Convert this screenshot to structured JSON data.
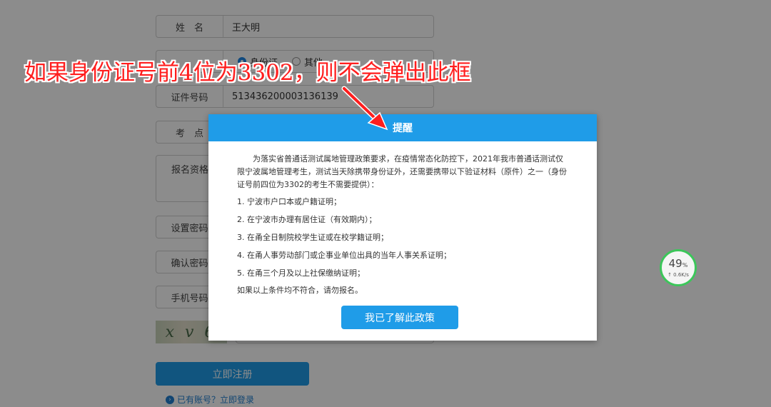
{
  "form": {
    "name_label": "姓　名",
    "name_value": "王大明",
    "idtype_option1": "身份证",
    "idtype_option2": "其他",
    "idno_label": "证件号码",
    "idno_value": "513436200003136139",
    "exam_label": "考　点",
    "qual_label": "报名资格",
    "pwd_label": "设置密码",
    "confirm_label": "确认密码",
    "phone_label": "手机号码",
    "captcha_text": "x v 6",
    "register_label": "立即注册",
    "login_prompt": "已有账号？立即登录"
  },
  "annotation": {
    "text": "如果身份证号前4位为3302，则不会弹出此框"
  },
  "modal": {
    "title": "提醒",
    "intro": "为落实省普通话测试属地管理政策要求，在疫情常态化防控下，2021年我市普通话测试仅限宁波属地管理考生，测试当天除携带身份证外，还需要携带以下验证材料（原件）之一（身份证号前四位为3302的考生不需要提供）：",
    "items": [
      "1. 宁波市户口本或户籍证明；",
      "2. 在宁波市办理有居住证（有效期内）；",
      "3. 在甬全日制院校学生证或在校学籍证明；",
      "4. 在甬人事劳动部门或企事业单位出具的当年人事关系证明；",
      "5. 在甬三个月及以上社保缴纳证明；"
    ],
    "closing": "如果以上条件均不符合，请勿报名。",
    "ack_label": "我已了解此政策"
  },
  "speed_widget": {
    "percent": "49",
    "percent_unit": "%",
    "rate": "0.6K/s"
  },
  "colors": {
    "primary": "#1f9ce8",
    "annotation_red": "#ff1e1e",
    "widget_green": "#3cc65a"
  }
}
